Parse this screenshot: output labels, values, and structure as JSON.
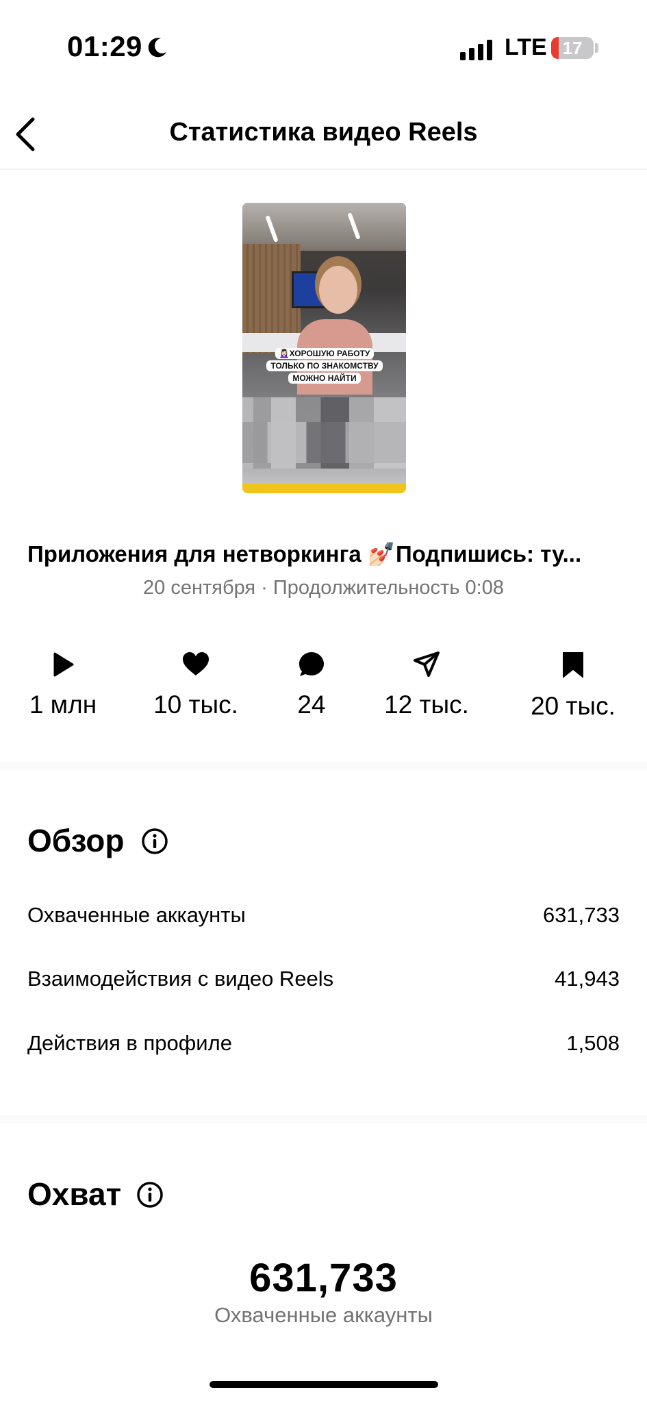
{
  "status_bar": {
    "time": "01:29",
    "network": "LTE",
    "battery_level": "17",
    "battery_fraction": 0.17,
    "icons": [
      "moon-icon",
      "signal-icon",
      "battery-icon"
    ]
  },
  "nav": {
    "title": "Статистика видео Reels",
    "back_icon": "chevron-left-icon"
  },
  "video": {
    "caption_lines": [
      "💆🏻‍♀️ХОРОШУЮ РАБОТУ",
      "ТОЛЬКО ПО ЗНАКОМСТВУ",
      "МОЖНО НАЙТИ"
    ],
    "title": "Приложения для нетворкинга 💅🏻Подпишись: ту...",
    "meta": "20 сентября · Продолжительность 0:08"
  },
  "metrics": [
    {
      "icon": "play-icon",
      "value": "1 млн"
    },
    {
      "icon": "heart-icon",
      "value": "10 тыс."
    },
    {
      "icon": "comment-icon",
      "value": "24"
    },
    {
      "icon": "share-icon",
      "value": "12 тыс."
    },
    {
      "icon": "bookmark-icon",
      "value": "20 тыс."
    }
  ],
  "overview": {
    "title": "Обзор",
    "rows": [
      {
        "label": "Охваченные аккаунты",
        "value": "631,733"
      },
      {
        "label": "Взаимодействия с видео Reels",
        "value": "41,943"
      },
      {
        "label": "Действия в профиле",
        "value": "1,508"
      }
    ]
  },
  "reach": {
    "title": "Охват",
    "value": "631,733",
    "caption": "Охваченные аккаунты"
  },
  "colors": {
    "text_primary": "#000000",
    "text_secondary": "#737373",
    "battery_low": "#eb3b30",
    "separator": "#fafafa"
  }
}
